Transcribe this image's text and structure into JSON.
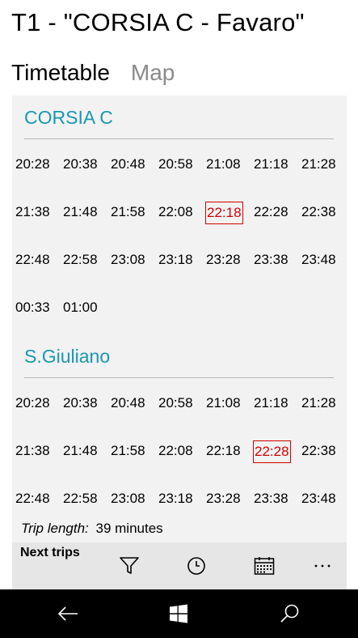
{
  "header": {
    "title": "T1 - \"CORSIA C - Favaro\""
  },
  "tabs": [
    {
      "label": "Timetable",
      "active": true
    },
    {
      "label": "Map",
      "active": false
    }
  ],
  "sections": [
    {
      "name": "CORSIA C",
      "times": [
        [
          "20:28",
          "20:38",
          "20:48",
          "20:58",
          "21:08",
          "21:18",
          "21:28"
        ],
        [
          "21:38",
          "21:48",
          "21:58",
          "22:08",
          "22:18",
          "22:28",
          "22:38"
        ],
        [
          "22:48",
          "22:58",
          "23:08",
          "23:18",
          "23:28",
          "23:38",
          "23:48"
        ],
        [
          "00:33",
          "01:00"
        ]
      ],
      "highlighted": "22:18"
    },
    {
      "name": "S.Giuliano",
      "times": [
        [
          "20:28",
          "20:38",
          "20:48",
          "20:58",
          "21:08",
          "21:18",
          "21:28"
        ],
        [
          "21:38",
          "21:48",
          "21:58",
          "22:08",
          "22:18",
          "22:28",
          "22:38"
        ],
        [
          "22:48",
          "22:58",
          "23:08",
          "23:18",
          "23:28",
          "23:38",
          "23:48"
        ]
      ],
      "highlighted": "22:28"
    }
  ],
  "trip_length": {
    "label": "Trip length:",
    "value": "39 minutes"
  },
  "appbar": {
    "label": "Next trips",
    "buttons": [
      "filter-icon",
      "clock-icon",
      "calendar-icon",
      "more-icon"
    ]
  },
  "navbar": {
    "buttons": [
      "back-icon",
      "windows-start-icon",
      "search-icon"
    ]
  },
  "colors": {
    "accent": "#1a97b3",
    "highlight": "#d40000",
    "panel": "#f2f2f2",
    "appbar": "#e6e6e6"
  }
}
